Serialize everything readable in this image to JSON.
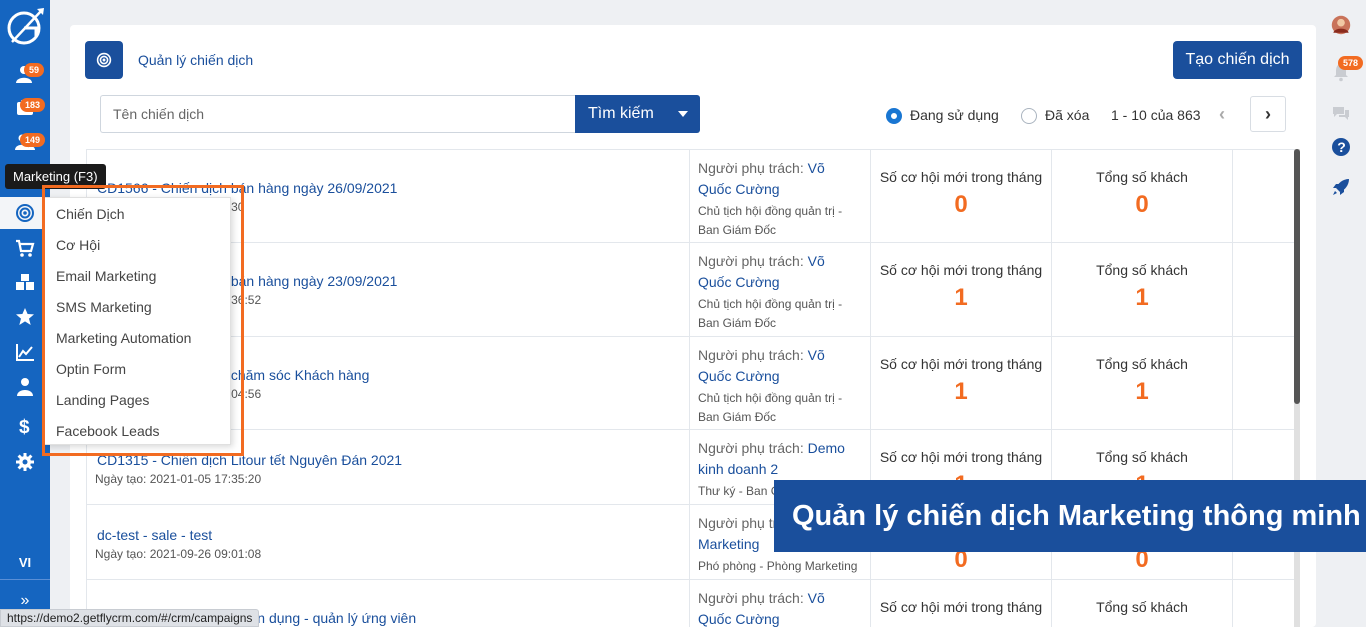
{
  "sidebar": {
    "badges": [
      "59",
      "183",
      "149"
    ],
    "language": "VI",
    "expand_glyph": "»"
  },
  "tooltip": "Marketing (F3)",
  "menu": {
    "items": [
      "Chiến Dịch",
      "Cơ Hội",
      "Email Marketing",
      "SMS Marketing",
      "Marketing Automation",
      "Optin Form",
      "Landing Pages",
      "Facebook Leads"
    ]
  },
  "header": {
    "title": "Quản lý chiến dịch",
    "create_label": "Tạo chiến dịch"
  },
  "search": {
    "placeholder": "Tên chiến dịch",
    "button_label": "Tìm kiếm"
  },
  "filter": {
    "active_label": "Đang sử dụng",
    "deleted_label": "Đã xóa",
    "selected": "active"
  },
  "pager": {
    "text": "1 - 10 của 863",
    "prev": "‹",
    "next": "›"
  },
  "table": {
    "owner_prefix": "Người phụ trách:",
    "opp_label": "Số cơ hội mới trong tháng",
    "cust_label": "Tổng số khách",
    "rows": [
      {
        "name": "CD1566 - Chiến dịch bán hàng ngày 26/09/2021",
        "date": "Ngày tạo: 2021-09-26 16:30",
        "owner": "Võ Quốc Cường",
        "role": "Chủ tịch hội đồng quản trị - Ban Giám Đốc",
        "opp": "0",
        "cust": "0"
      },
      {
        "name": "CD1565 - Chiến dịch bán hàng ngày 23/09/2021",
        "date": "Ngày tạo: 2021-09-23 08:36:52",
        "owner": "Võ Quốc Cường",
        "role": "Chủ tịch hội đồng quản trị - Ban Giám Đốc",
        "opp": "1",
        "cust": "1"
      },
      {
        "name": "CD1564 - Chiến dịch chăm sóc Khách hàng",
        "date": "Ngày tạo: 2021-09-22 10:04:56",
        "owner": "Võ Quốc Cường",
        "role": "Chủ tịch hội đồng quản trị - Ban Giám Đốc",
        "opp": "1",
        "cust": "1"
      },
      {
        "name": "CD1315 - Chiến dịch Litour tết Nguyên Đán 2021",
        "date": "Ngày tạo: 2021-01-05 17:35:20",
        "owner": "Demo kinh doanh 2",
        "role": "Thư ký - Ban Giám Đốc",
        "opp": "1",
        "cust": "1"
      },
      {
        "name": "dc-test - sale - test",
        "date": "Ngày tạo: 2021-09-26 09:01:08",
        "owner": "Demo Marketing",
        "role": "Phó phòng - Phòng Marketing",
        "opp": "0",
        "cust": "0"
      },
      {
        "name": "CD1000 - Chiến dịch tuyển dụng - quản lý ứng viên",
        "date": "",
        "owner": "Võ Quốc Cường",
        "role": "",
        "opp": "",
        "cust": ""
      }
    ]
  },
  "right_badge": "578",
  "banner": "Quản lý chiến dịch Marketing thông minh",
  "status_url": "https://demo2.getflycrm.com/#/crm/campaigns",
  "colors": {
    "primary": "#1565c0",
    "dark_primary": "#1a4f9c",
    "accent": "#f26b21"
  }
}
